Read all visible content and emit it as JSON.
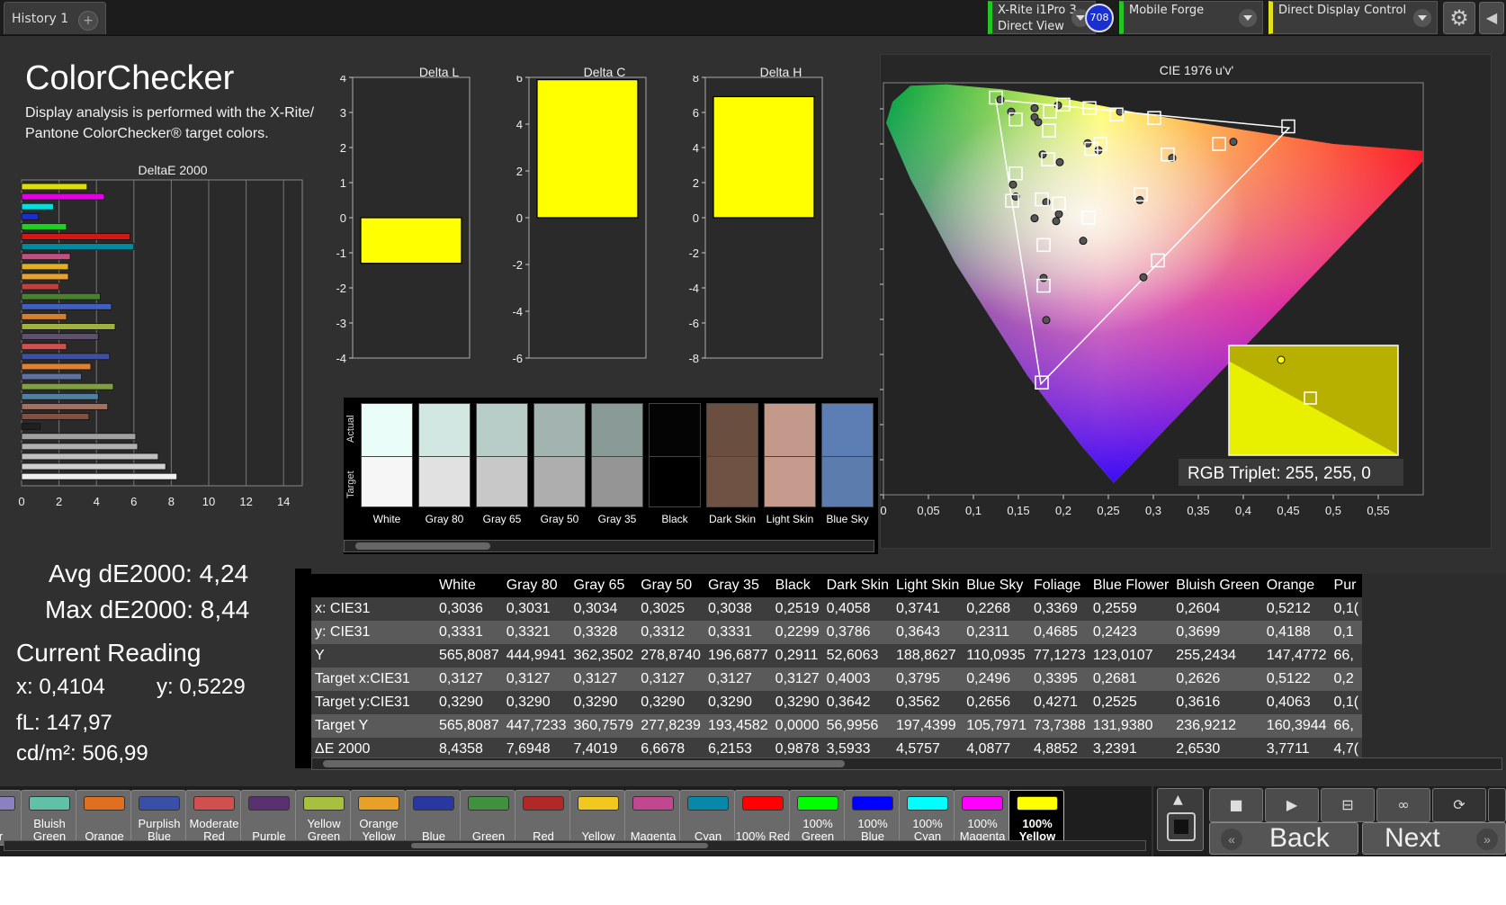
{
  "topbar": {
    "tab_label": "History 1",
    "add_tab": "+",
    "device1_line1": "X-Rite i1Pro 3",
    "device1_line2": "Direct View",
    "badge": "708",
    "device2": "Mobile Forge",
    "device3": "Direct Display Control"
  },
  "header": {
    "title": "ColorChecker",
    "description": "Display analysis is performed with the X-Rite/ Pantone ColorChecker® target colors."
  },
  "stats": {
    "avg": "Avg dE2000: 4,24",
    "max": "Max dE2000: 8,44",
    "current_reading": "Current Reading",
    "x": "x: 0,4104",
    "y": "y: 0,5229",
    "fl": "fL: 147,97",
    "cdm2": "cd/m²: 506,99"
  },
  "colors": {
    "accent_yellow": "#ffff00",
    "bg": "#303030",
    "device_green": "#22c722"
  },
  "chart_data": [
    {
      "type": "bar",
      "orientation": "horizontal",
      "title": "DeltaE 2000",
      "xlim": [
        0,
        15
      ],
      "x_ticks": [
        "0",
        "2",
        "4",
        "6",
        "8",
        "10",
        "12",
        "14"
      ],
      "values": [
        3.5,
        4.4,
        1.7,
        0.9,
        2.4,
        5.8,
        6.0,
        2.6,
        2.5,
        2.5,
        2.0,
        4.2,
        4.8,
        2.4,
        5.0,
        4.1,
        2.4,
        4.7,
        3.7,
        3.2,
        4.9,
        4.1,
        4.6,
        3.6,
        0.99,
        6.1,
        6.2,
        7.3,
        7.7,
        8.3
      ],
      "colors": [
        "#dede00",
        "#e000e0",
        "#00e0e0",
        "#1a2fd0",
        "#20d020",
        "#d01818",
        "#008aa0",
        "#c05080",
        "#e0b020",
        "#e8a030",
        "#c04040",
        "#4a8030",
        "#4060c0",
        "#d08030",
        "#a0b040",
        "#605070",
        "#d05050",
        "#4050a0",
        "#e08030",
        "#6070a0",
        "#80a040",
        "#5080a0",
        "#a07060",
        "#805040",
        "#202020",
        "#a0a0a0",
        "#b0b0b0",
        "#c0c0c0",
        "#d0d0d0",
        "#f0f0f0"
      ]
    },
    {
      "type": "bar",
      "title": "Delta L",
      "ylim": [
        -4,
        4
      ],
      "y_ticks": [
        "4",
        "3",
        "2",
        "1",
        "0",
        "-1",
        "-2",
        "-3",
        "-4"
      ],
      "values": [
        -1.3
      ],
      "color": "#ffff00"
    },
    {
      "type": "bar",
      "title": "Delta C",
      "ylim": [
        -6,
        6
      ],
      "y_ticks": [
        "6",
        "4",
        "2",
        "0",
        "-2",
        "-4",
        "-6"
      ],
      "values": [
        5.9
      ],
      "color": "#ffff00"
    },
    {
      "type": "bar",
      "title": "Delta H",
      "ylim": [
        -8,
        8
      ],
      "y_ticks": [
        "8",
        "6",
        "4",
        "2",
        "0",
        "-2",
        "-4",
        "-6",
        "-8"
      ],
      "values": [
        6.9
      ],
      "color": "#ffff00"
    },
    {
      "type": "scatter",
      "title": "CIE 1976 u'v'",
      "xlim": [
        0,
        0.6
      ],
      "ylim": [
        0,
        0.6
      ],
      "x_ticks": [
        "0",
        "0,05",
        "0,1",
        "0,15",
        "0,2",
        "0,25",
        "0,3",
        "0,35",
        "0,4",
        "0,45",
        "0,5",
        "0,55"
      ],
      "y_ticks": [
        "0",
        "0,05",
        "0,1",
        "0,15",
        "0,2",
        "0,25",
        "0,3",
        "0,35",
        "0,4",
        "0,45",
        "0,5",
        "0,55"
      ],
      "targets": [
        [
          0.125,
          0.566
        ],
        [
          0.147,
          0.535
        ],
        [
          0.147,
          0.458
        ],
        [
          0.143,
          0.419
        ],
        [
          0.176,
          0.421
        ],
        [
          0.195,
          0.415
        ],
        [
          0.184,
          0.519
        ],
        [
          0.183,
          0.478
        ],
        [
          0.185,
          0.546
        ],
        [
          0.2,
          0.556
        ],
        [
          0.229,
          0.551
        ],
        [
          0.259,
          0.542
        ],
        [
          0.301,
          0.537
        ],
        [
          0.231,
          0.493
        ],
        [
          0.241,
          0.5
        ],
        [
          0.316,
          0.485
        ],
        [
          0.373,
          0.5
        ],
        [
          0.45,
          0.525
        ],
        [
          0.286,
          0.428
        ],
        [
          0.228,
          0.395
        ],
        [
          0.178,
          0.356
        ],
        [
          0.305,
          0.334
        ],
        [
          0.178,
          0.298
        ],
        [
          0.176,
          0.16
        ]
      ],
      "measured": [
        [
          0.13,
          0.563
        ],
        [
          0.142,
          0.546
        ],
        [
          0.168,
          0.551
        ],
        [
          0.194,
          0.555
        ],
        [
          0.168,
          0.538
        ],
        [
          0.172,
          0.531
        ],
        [
          0.144,
          0.442
        ],
        [
          0.147,
          0.425
        ],
        [
          0.181,
          0.417
        ],
        [
          0.168,
          0.394
        ],
        [
          0.195,
          0.4
        ],
        [
          0.192,
          0.39
        ],
        [
          0.177,
          0.485
        ],
        [
          0.227,
          0.501
        ],
        [
          0.263,
          0.546
        ],
        [
          0.239,
          0.491
        ],
        [
          0.321,
          0.48
        ],
        [
          0.389,
          0.503
        ],
        [
          0.285,
          0.42
        ],
        [
          0.222,
          0.362
        ],
        [
          0.178,
          0.309
        ],
        [
          0.289,
          0.31
        ],
        [
          0.181,
          0.249
        ],
        [
          0.196,
          0.474
        ]
      ],
      "inset_label": "RGB Triplet: 255, 255, 0"
    }
  ],
  "swatches": {
    "actual_label": "Actual",
    "target_label": "Target",
    "items": [
      {
        "label": "White",
        "actual": "#eafdf9",
        "target": "#f6f6f6"
      },
      {
        "label": "Gray 80",
        "actual": "#d2e6e2",
        "target": "#e1e1e1"
      },
      {
        "label": "Gray 65",
        "actual": "#b8ccc8",
        "target": "#c8c8c8"
      },
      {
        "label": "Gray 50",
        "actual": "#a2b3b0",
        "target": "#aeaeae"
      },
      {
        "label": "Gray 35",
        "actual": "#8a9a97",
        "target": "#959595"
      },
      {
        "label": "Black",
        "actual": "#040404",
        "target": "#000000"
      },
      {
        "label": "Dark Skin",
        "actual": "#6a4e40",
        "target": "#6f5244"
      },
      {
        "label": "Light Skin",
        "actual": "#c2998a",
        "target": "#c69a8c"
      },
      {
        "label": "Blue Sky",
        "actual": "#5c7eb4",
        "target": "#5b7cac"
      }
    ]
  },
  "table": {
    "columns": [
      "White",
      "Gray 80",
      "Gray 65",
      "Gray 50",
      "Gray 35",
      "Black",
      "Dark Skin",
      "Light Skin",
      "Blue Sky",
      "Foliage",
      "Blue Flower",
      "Bluish Green",
      "Orange",
      "Pur"
    ],
    "rows": [
      {
        "label": "x: CIE31",
        "values": [
          "0,3036",
          "0,3031",
          "0,3034",
          "0,3025",
          "0,3038",
          "0,2519",
          "0,4058",
          "0,3741",
          "0,2268",
          "0,3369",
          "0,2559",
          "0,2604",
          "0,5212",
          "0,1("
        ]
      },
      {
        "label": "y: CIE31",
        "values": [
          "0,3331",
          "0,3321",
          "0,3328",
          "0,3312",
          "0,3331",
          "0,2299",
          "0,3786",
          "0,3643",
          "0,2311",
          "0,4685",
          "0,2423",
          "0,3699",
          "0,4188",
          "0,1"
        ]
      },
      {
        "label": "Y",
        "values": [
          "565,8087",
          "444,9941",
          "362,3502",
          "278,8740",
          "196,6877",
          "0,2911",
          "52,6063",
          "188,8627",
          "110,0935",
          "77,1273",
          "123,0107",
          "255,2434",
          "147,4772",
          "66,"
        ]
      },
      {
        "label": "Target x:CIE31",
        "values": [
          "0,3127",
          "0,3127",
          "0,3127",
          "0,3127",
          "0,3127",
          "0,3127",
          "0,4003",
          "0,3795",
          "0,2496",
          "0,3395",
          "0,2681",
          "0,2626",
          "0,5122",
          "0,2"
        ]
      },
      {
        "label": "Target y:CIE31",
        "values": [
          "0,3290",
          "0,3290",
          "0,3290",
          "0,3290",
          "0,3290",
          "0,3290",
          "0,3642",
          "0,3562",
          "0,2656",
          "0,4271",
          "0,2525",
          "0,3616",
          "0,4063",
          "0,1("
        ]
      },
      {
        "label": "Target Y",
        "values": [
          "565,8087",
          "447,7233",
          "360,7579",
          "277,8239",
          "193,4582",
          "0,0000",
          "56,9956",
          "197,4399",
          "105,7971",
          "73,7388",
          "131,9380",
          "236,9212",
          "160,3944",
          "66,"
        ]
      },
      {
        "label": "ΔE 2000",
        "values": [
          "8,4358",
          "7,6948",
          "7,4019",
          "6,6678",
          "6,2153",
          "0,9878",
          "3,5933",
          "4,5757",
          "4,0877",
          "4,8852",
          "3,2391",
          "2,6530",
          "3,7711",
          "4,7("
        ]
      }
    ]
  },
  "patches": [
    {
      "label": "ver",
      "color": "#8a82c0"
    },
    {
      "label": "Bluish Green",
      "color": "#60c0a8"
    },
    {
      "label": "Orange",
      "color": "#e07020"
    },
    {
      "label": "Purplish Blue",
      "color": "#3a50a8"
    },
    {
      "label": "Moderate Red",
      "color": "#d05050"
    },
    {
      "label": "Purple",
      "color": "#5a3070"
    },
    {
      "label": "Yellow Green",
      "color": "#a8c040"
    },
    {
      "label": "Orange Yellow",
      "color": "#e8a028"
    },
    {
      "label": "Blue",
      "color": "#2838a0"
    },
    {
      "label": "Green",
      "color": "#409040"
    },
    {
      "label": "Red",
      "color": "#b02828"
    },
    {
      "label": "Yellow",
      "color": "#f0c820"
    },
    {
      "label": "Magenta",
      "color": "#c04890"
    },
    {
      "label": "Cyan",
      "color": "#0888a8"
    },
    {
      "label": "100% Red",
      "color": "#ff0000"
    },
    {
      "label": "100% Green",
      "color": "#00ff00"
    },
    {
      "label": "100% Blue",
      "color": "#0000ff"
    },
    {
      "label": "100% Cyan",
      "color": "#00ffff"
    },
    {
      "label": "100% Magenta",
      "color": "#ff00ff"
    },
    {
      "label": "100% Yellow",
      "color": "#ffff00"
    }
  ],
  "controls": {
    "back": "Back",
    "next": "Next"
  }
}
